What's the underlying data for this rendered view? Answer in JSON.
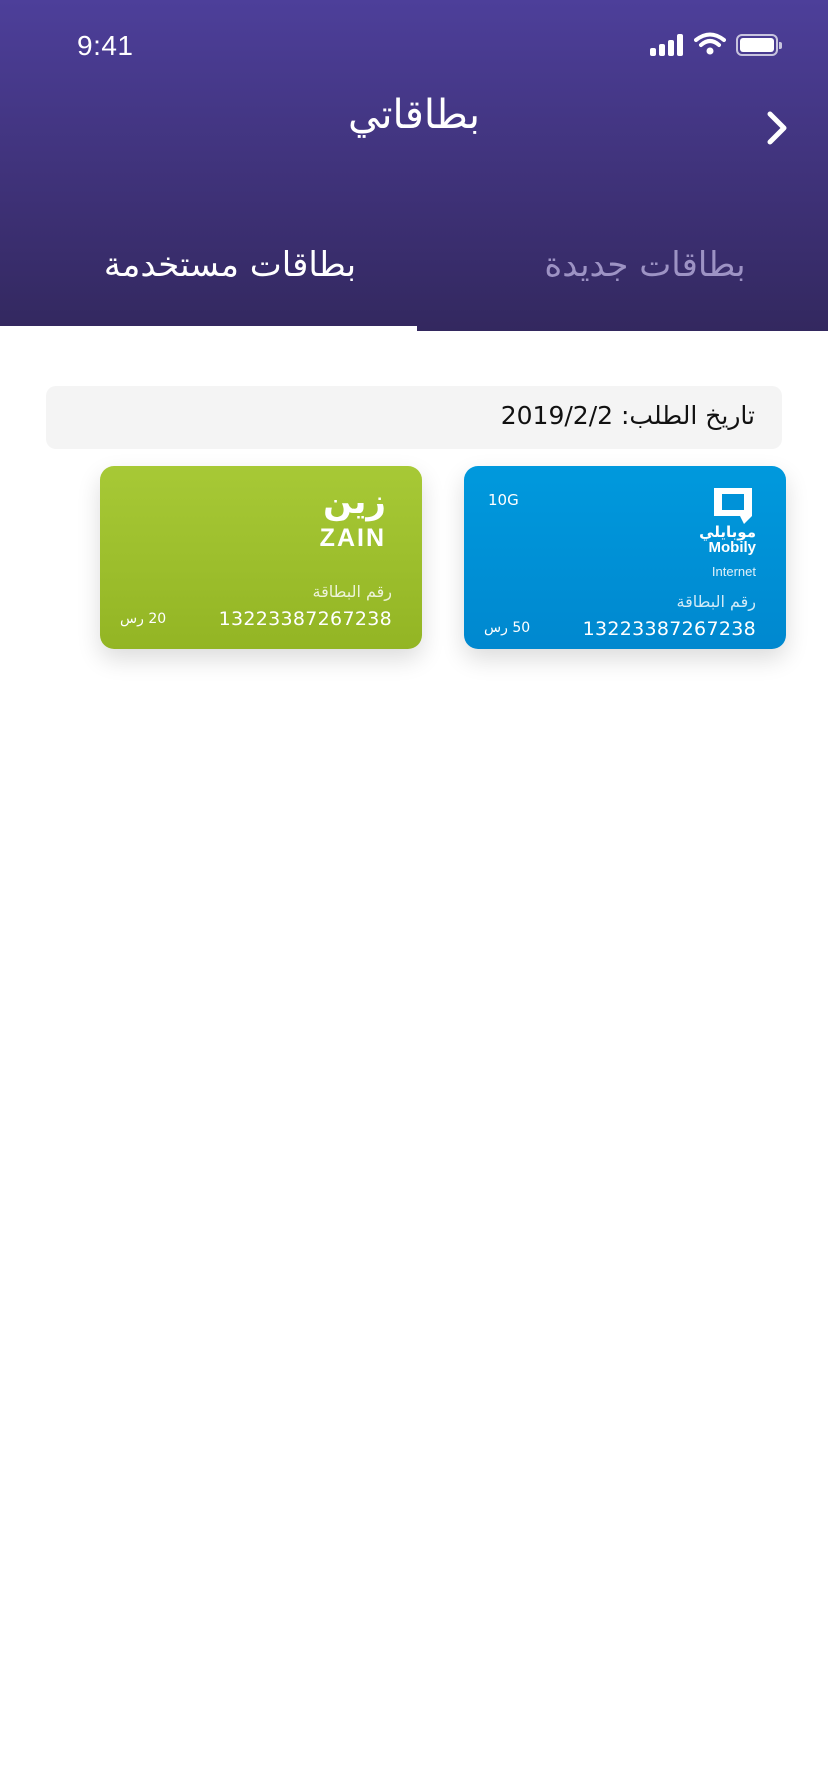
{
  "status_bar": {
    "time": "9:41"
  },
  "header": {
    "title": "بطاقاتي",
    "back_icon": "chevron-right-icon"
  },
  "tabs": [
    {
      "label": "بطاقات مستخدمة",
      "active": true
    },
    {
      "label": "بطاقات جديدة",
      "active": false
    }
  ],
  "order": {
    "date_text": "تاريخ الطلب: 2019/2/2"
  },
  "cards": [
    {
      "brand": "mobily",
      "brand_name_ar": "موبايلي",
      "brand_name_en": "Mobily",
      "type": "Internet",
      "capacity": "10G",
      "number_label": "رقم البطاقة",
      "number": "13223387267238",
      "price": "50 رس",
      "color": "#0092d8"
    },
    {
      "brand": "zain",
      "brand_name_ar": "زين",
      "brand_name_en": "ZAIN",
      "number_label": "رقم البطاقة",
      "number": "13223387267238",
      "price": "20 رس",
      "color": "#9fc22e"
    }
  ],
  "colors": {
    "header_top": "#4d3f9a",
    "header_bottom": "#33285f",
    "inactive_tab": "#9d93c4"
  }
}
